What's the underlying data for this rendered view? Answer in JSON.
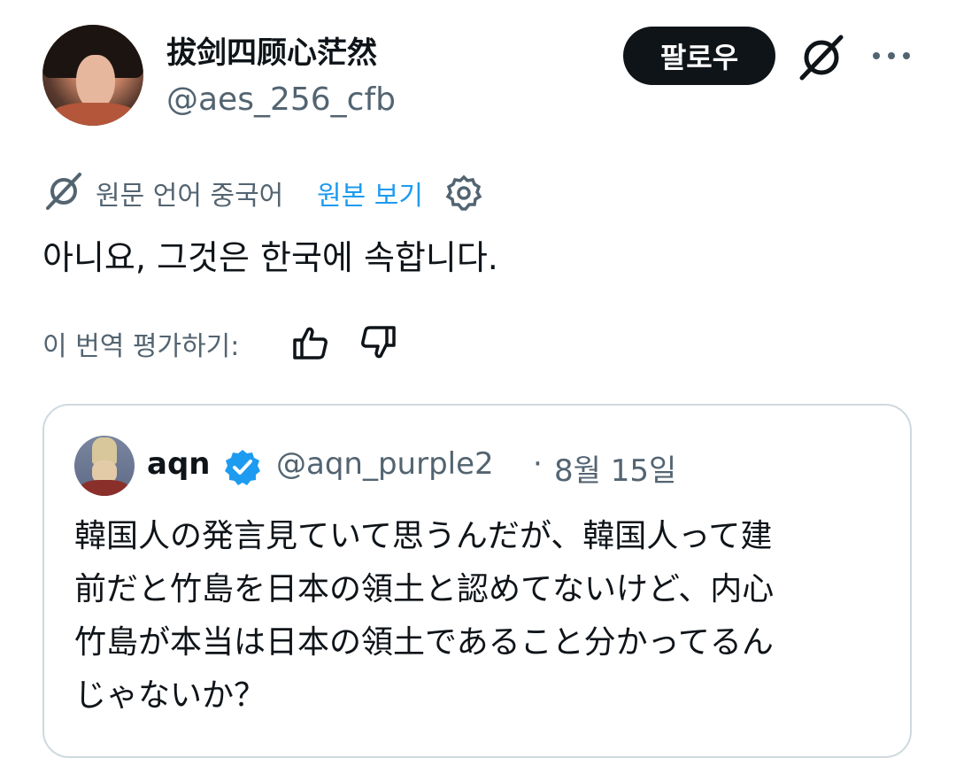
{
  "author": {
    "display_name": "拔剑四顾心茫然",
    "handle": "@aes_256_cfb",
    "follow_label": "팔로우"
  },
  "translation": {
    "notice": "원문 언어 중국어",
    "show_original": "원본 보기",
    "translated_text": "아니요, 그것은 한국에 속합니다.",
    "rate_label": "이 번역 평가하기:"
  },
  "quoted": {
    "display_name": "aqn",
    "handle": "@aqn_purple2",
    "separator": "·",
    "date": "8월 15일",
    "lines": [
      "韓国人の発言見ていて思うんだが、韓国人って建",
      "前だと竹島を日本の領土と認めてないけど、内心",
      "竹島が本当は日本の領土であること分かってるん",
      "じゃないか？"
    ]
  },
  "icons": [
    "avatar",
    "grok-icon",
    "more-icon",
    "translate-icon",
    "gear-icon",
    "thumbs-up-icon",
    "thumbs-down-icon",
    "verified-badge-icon"
  ],
  "colors": {
    "link": "#1d9bf0",
    "muted": "#536471",
    "text": "#0f1419",
    "follow_bg": "#0f1419",
    "border": "#cfd9de"
  }
}
